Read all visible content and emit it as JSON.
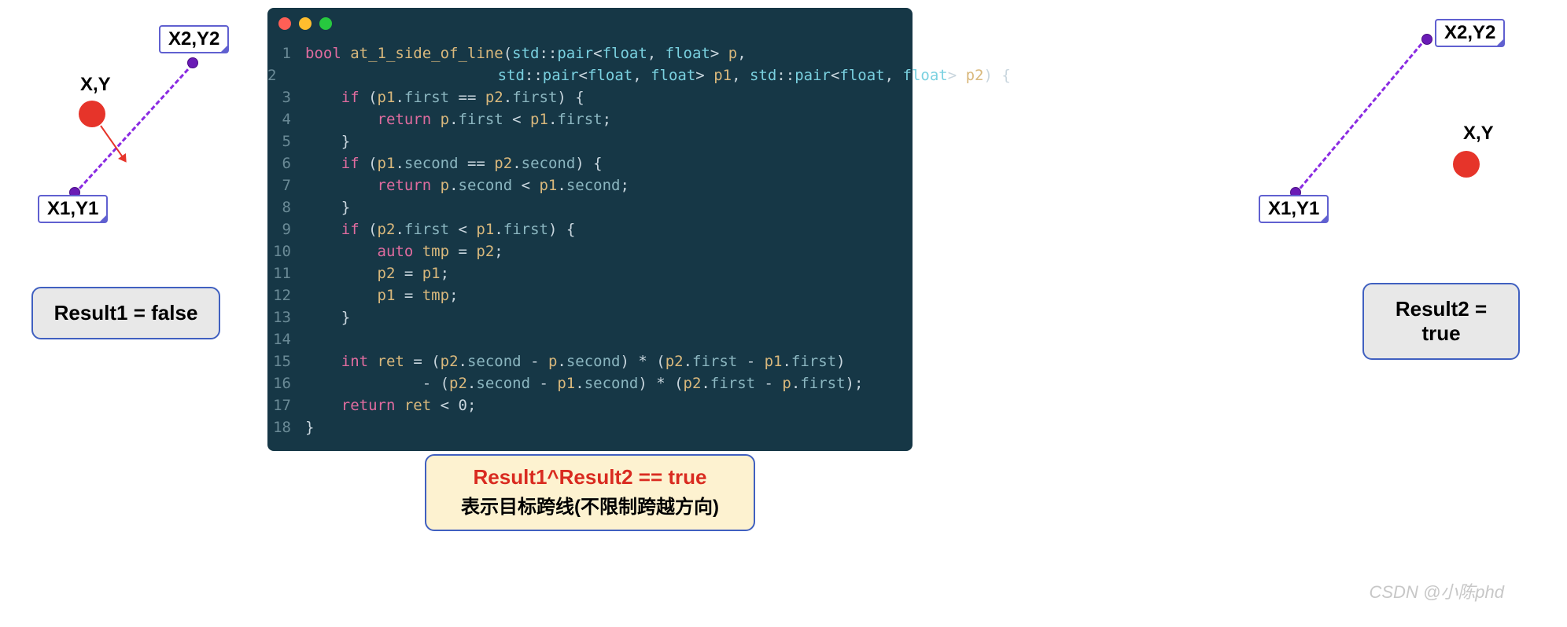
{
  "left_diagram": {
    "label_p2": "X2,Y2",
    "label_p1": "X1,Y1",
    "label_p": "X,Y"
  },
  "right_diagram": {
    "label_p2": "X2,Y2",
    "label_p1": "X1,Y1",
    "label_p": "X,Y"
  },
  "result_left": "Result1 = false",
  "result_right_l1": "Result2 =",
  "result_right_l2": "true",
  "code": {
    "lines": [
      "bool at_1_side_of_line(std::pair<float, float> p,",
      "                       std::pair<float, float> p1, std::pair<float, float> p2) {",
      "    if (p1.first == p2.first) {",
      "        return p.first < p1.first;",
      "    }",
      "    if (p1.second == p2.second) {",
      "        return p.second < p1.second;",
      "    }",
      "    if (p2.first < p1.first) {",
      "        auto tmp = p2;",
      "        p2 = p1;",
      "        p1 = tmp;",
      "    }",
      "",
      "    int ret = (p2.second - p.second) * (p2.first - p1.first)",
      "             - (p2.second - p1.second) * (p2.first - p.first);",
      "    return ret < 0;",
      "}"
    ]
  },
  "summary": {
    "line1": "Result1^Result2 == true",
    "line2": "表示目标跨线(不限制跨越方向)"
  },
  "watermark": "CSDN @小陈phd"
}
